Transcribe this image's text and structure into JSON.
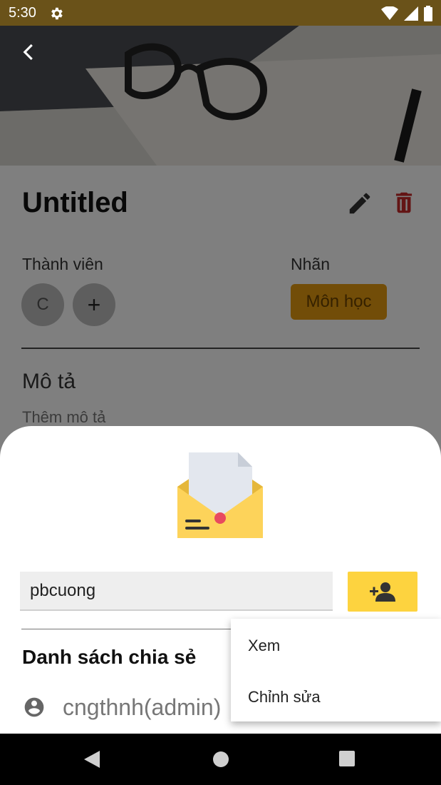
{
  "status_bar": {
    "time": "5:30",
    "icons": [
      "settings-icon",
      "wifi-icon",
      "signal-icon",
      "battery-icon"
    ]
  },
  "card": {
    "title": "Untitled",
    "members_label": "Thành viên",
    "member_initial": "C",
    "add_member_symbol": "+",
    "labels_label": "Nhãn",
    "label_chip": "Môn học",
    "description_label": "Mô tả",
    "description_placeholder": "Thêm mô tả"
  },
  "share_sheet": {
    "input_value": "pbcuong",
    "list_title": "Danh sách chia sẻ",
    "users": [
      {
        "name": "cngthnh(admin)"
      }
    ]
  },
  "permission_menu": {
    "items": [
      "Xem",
      "Chỉnh sửa"
    ]
  },
  "colors": {
    "status_bar": "#6a5219",
    "accent_yellow": "#fdd33f",
    "label_chip": "#e59a10",
    "delete_red": "#c62828"
  }
}
